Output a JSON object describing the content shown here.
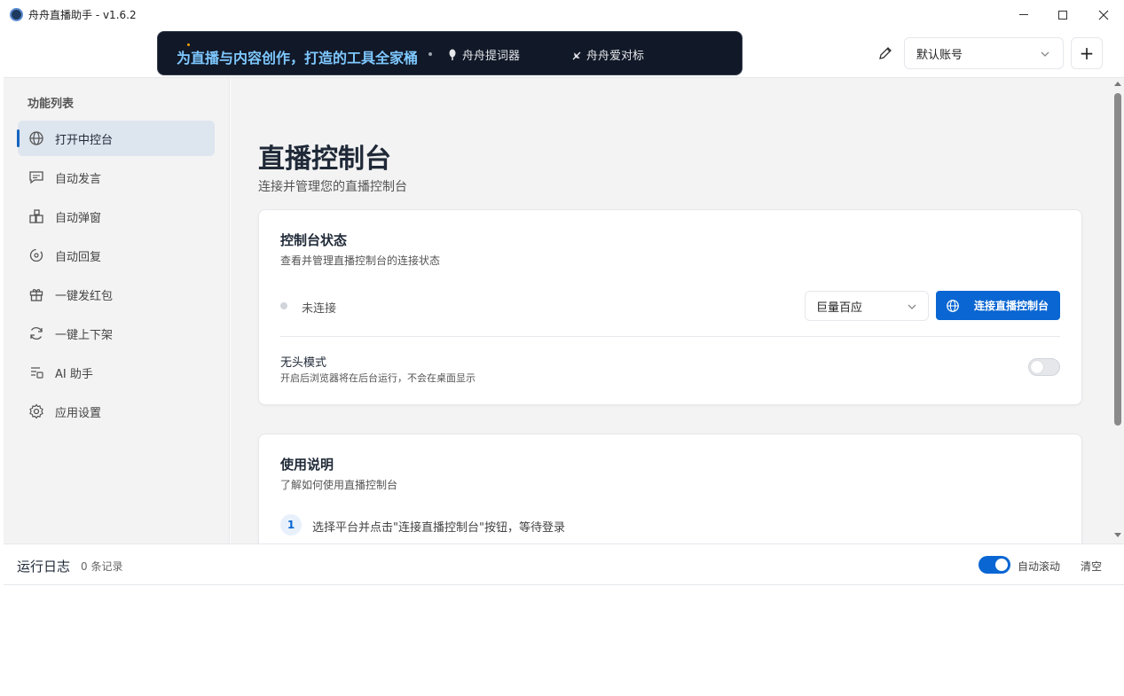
{
  "app": {
    "title": "舟舟直播助手 - v1.6.2"
  },
  "header": {
    "banner": {
      "slogan": "为直播与内容创作，打造的工具全家桶",
      "items": [
        "舟舟提词器",
        "舟舟爱对标"
      ]
    },
    "account": {
      "selected": "默认账号"
    },
    "add_label": "+"
  },
  "sidebar": {
    "title": "功能列表",
    "items": [
      {
        "label": "打开中控台",
        "icon": "globe-icon",
        "active": true
      },
      {
        "label": "自动发言",
        "icon": "message-icon",
        "active": false
      },
      {
        "label": "自动弹窗",
        "icon": "popup-icon",
        "active": false
      },
      {
        "label": "自动回复",
        "icon": "reply-icon",
        "active": false
      },
      {
        "label": "一键发红包",
        "icon": "gift-icon",
        "active": false
      },
      {
        "label": "一键上下架",
        "icon": "refresh-icon",
        "active": false
      },
      {
        "label": "AI 助手",
        "icon": "ai-icon",
        "active": false
      },
      {
        "label": "应用设置",
        "icon": "gear-icon",
        "active": false
      }
    ]
  },
  "main": {
    "title": "直播控制台",
    "subtitle": "连接并管理您的直播控制台",
    "status_card": {
      "title": "控制台状态",
      "description": "查看并管理直播控制台的连接状态",
      "status": "未连接",
      "platform": "巨量百应",
      "connect_label": "连接直播控制台",
      "headless_title": "无头模式",
      "headless_desc": "开启后浏览器将在后台运行，不会在桌面显示",
      "headless_enabled": false
    },
    "guide_card": {
      "title": "使用说明",
      "description": "了解如何使用直播控制台",
      "steps": [
        {
          "num": "1",
          "text": "选择平台并点击\"连接直播控制台\"按钮，等待登录"
        }
      ]
    }
  },
  "log": {
    "title": "运行日志",
    "count": "0 条记录",
    "autoscroll_label": "自动滚动",
    "autoscroll_enabled": true,
    "clear_label": "清空"
  },
  "colors": {
    "accent": "#0a66d2",
    "banner_bg": "#111827",
    "slogan": "#7ec8ff"
  }
}
